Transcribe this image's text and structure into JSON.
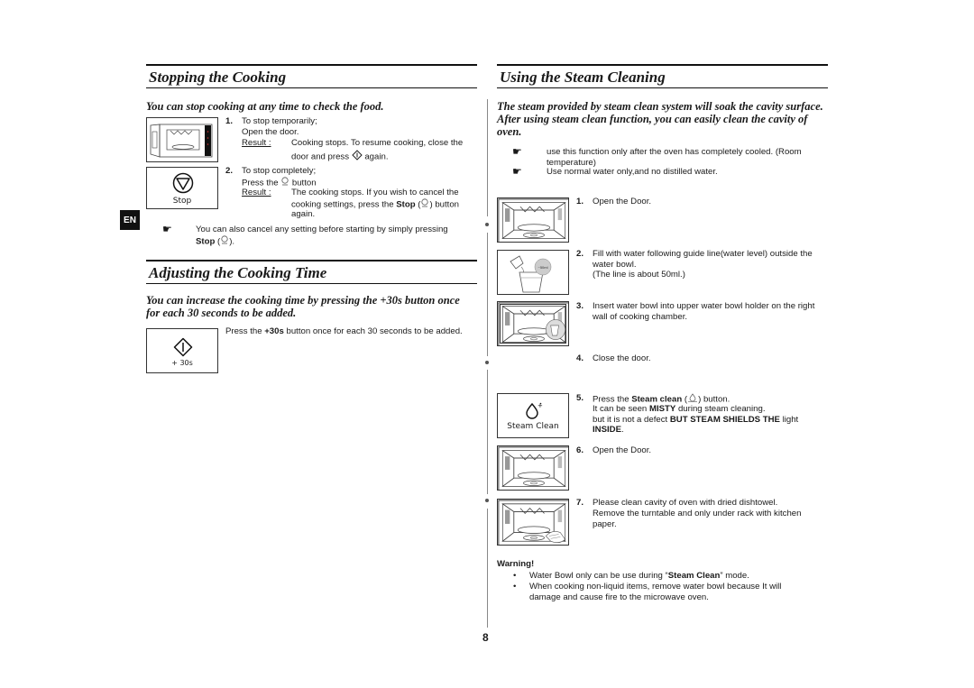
{
  "language_badge": "EN",
  "page_number": "8",
  "stopping": {
    "title": "Stopping the Cooking",
    "intro": "You can stop cooking at any time to check the food.",
    "step1": {
      "number": "1.",
      "line1": "To stop temporarily;",
      "line2": "Open the door.",
      "result_label": "Result :",
      "result_line1": "Cooking stops. To resume cooking, close the",
      "result_line2a": "door and press",
      "result_line2b": "again."
    },
    "step2": {
      "number": "2.",
      "line1": "To stop completely;",
      "line2a": "Press the",
      "line2b": "button",
      "result_label": "Result :",
      "result_line1": "The cooking stops. If you wish to cancel the",
      "result_line2a": "cooking settings, press the",
      "result_line2_bold": "Stop",
      "result_line2b": ") button",
      "result_line3": "again."
    },
    "stop_button_label": "Stop",
    "note_line1": "You can also cancel any setting before starting by simply pressing",
    "note_bold": "Stop",
    "note_end": ")."
  },
  "adjusting": {
    "title": "Adjusting the Cooking Time",
    "intro_line1": "You can increase the cooking time by pressing the +30s button once",
    "intro_line2": "for each 30 seconds to be added.",
    "text_a": "Press the",
    "text_bold": "+30s",
    "text_b": "button once for each 30 seconds to be added.",
    "button_label": "+ 30s"
  },
  "steam": {
    "title": "Using the Steam Cleaning",
    "intro_line1": "The steam provided by steam clean system will soak the cavity surface.",
    "intro_line2": "After using steam clean function, you can easily clean the cavity of",
    "intro_line3": "oven.",
    "notes": [
      {
        "line1": "use this function only after the oven has completely cooled. (Room",
        "line2": "temperature)"
      },
      {
        "line1": "Use normal water only,and no distilled water.",
        "line2": ""
      }
    ],
    "steps": [
      {
        "number": "1.",
        "lines": [
          "Open the Door."
        ]
      },
      {
        "number": "2.",
        "lines": [
          "Fill with water following guide line(water level) outside the",
          "water bowl.",
          "(The line is about 50ml.)"
        ]
      },
      {
        "number": "3.",
        "lines": [
          "Insert water bowl into upper water bowl holder on the right",
          "wall of cooking chamber."
        ]
      },
      {
        "number": "4.",
        "lines": [
          "Close the door."
        ]
      },
      {
        "number": "5.",
        "line1a": "Press the",
        "line1_bold": "Steam clean",
        "line1b": ") button.",
        "line2a": "It can be seen",
        "line2_bold": "MISTY",
        "line2b": "during steam cleaning.",
        "line3a": "but it is not a defect",
        "line3_bold": "BUT STEAM SHIELDS THE",
        "line3b": "light",
        "line4_bold": "INSIDE",
        "line4b": "."
      },
      {
        "number": "6.",
        "lines": [
          "Open the Door."
        ]
      },
      {
        "number": "7.",
        "lines": [
          "Please clean cavity of oven with dried dishtowel.",
          "Remove the turntable and only under rack with kitchen",
          "paper."
        ]
      }
    ],
    "water_label": "~50ml",
    "steam_button_label": "Steam Clean",
    "warning": {
      "title": "Warning!",
      "item1a": "Water Bowl only can be use during “",
      "item1_bold": "Steam Clean",
      "item1b": "” mode.",
      "item2_line1": "When cooking non-liquid items, remove water bowl because It will",
      "item2_line2": "damage and cause fire to the microwave oven."
    }
  }
}
